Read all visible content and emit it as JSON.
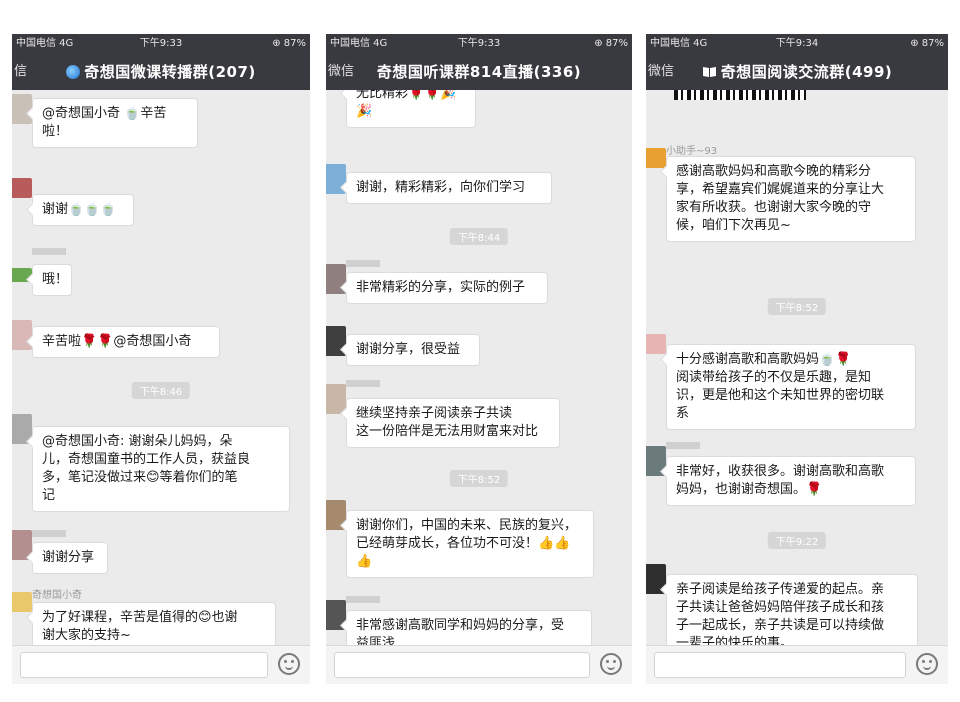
{
  "screens": [
    {
      "status": {
        "carrier": "中国电信  4G",
        "time": "下午9:33",
        "battery": "⊕ 87%"
      },
      "back": "信",
      "title": "奇想国微课转播群(207)",
      "messages": [
        {
          "text": "@奇想国小奇 🍵辛苦啦！"
        },
        {
          "text": "谢谢🍵🍵🍵"
        },
        {
          "text": "哦！"
        },
        {
          "text": "辛苦啦🌹🌹@奇想国小奇"
        },
        {
          "stamp": "下午8:46"
        },
        {
          "text": "@奇想国小奇: 谢谢朵儿妈妈，朵\n儿，奇想国童书的工作人员，获益良\n多，笔记没做过来😊等着你们的笔\n记"
        },
        {
          "text": "谢谢分享"
        },
        {
          "sender": "奇想国小奇",
          "text": "为了好课程，辛苦是值得的😊也谢\n谢大家的支持~"
        }
      ]
    },
    {
      "status": {
        "carrier": "中国电信  4G",
        "time": "下午9:33",
        "battery": "⊕ 87%"
      },
      "back": "微信",
      "title": "奇想国听课群814直播(336)",
      "messages": [
        {
          "text": "无比精彩🌹🌹🎉🎉"
        },
        {
          "text": "谢谢，精彩精彩，向你们学习"
        },
        {
          "stamp": "下午8:44"
        },
        {
          "text": "非常精彩的分享，实际的例子"
        },
        {
          "text": "谢谢分享，很受益"
        },
        {
          "text": "继续坚持亲子阅读亲子共读\n这一份陪伴是无法用财富来对比"
        },
        {
          "stamp": "下午8:52"
        },
        {
          "text": "谢谢你们，中国的未来、民族的复兴，\n已经萌芽成长，各位功不可没！👍👍\n👍"
        },
        {
          "text": "非常感谢高歌同学和妈妈的分享，受\n益匪浅"
        }
      ]
    },
    {
      "status": {
        "carrier": "中国电信  4G",
        "time": "下午9:34",
        "battery": "⊕ 87%"
      },
      "back": "微信",
      "title": "奇想国阅读交流群(499)",
      "messages": [
        {
          "sender": "小助手~93",
          "text": "感谢高歌妈妈和高歌今晚的精彩分\n享，希望嘉宾们娓娓道来的分享让大\n家有所收获。也谢谢大家今晚的守\n候，咱们下次再见~"
        },
        {
          "stamp": "下午8:52"
        },
        {
          "text": "十分感谢高歌和高歌妈妈🍵🌹\n阅读带给孩子的不仅是乐趣，是知\n识，更是他和这个未知世界的密切联\n系"
        },
        {
          "text": "非常好，收获很多。谢谢高歌和高歌\n妈妈，也谢谢奇想国。🌹"
        },
        {
          "stamp": "下午9:22"
        },
        {
          "text": "亲子阅读是给孩子传递爱的起点。亲\n子共读让爸爸妈妈陪伴孩子成长和孩\n子一起成长，亲子共读是可以持续做\n一辈子的快乐的事。"
        }
      ]
    }
  ],
  "colors": {
    "navbar": "#393a3f",
    "background": "#ebebeb",
    "bubble": "#ffffff",
    "timestamp": "#d6d6d6"
  },
  "icons": [
    "signal-icon",
    "globe-icon",
    "book-icon",
    "emoji-icon",
    "plus-icon"
  ]
}
